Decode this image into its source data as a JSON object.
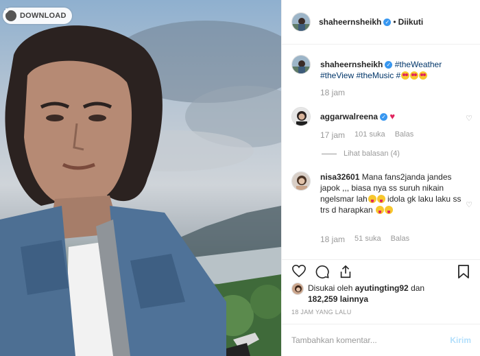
{
  "photo": {
    "download_label": "DOWNLOAD"
  },
  "post": {
    "author": "shaheernsheikh",
    "separator": "•",
    "follow_status": "Diikuti"
  },
  "caption": {
    "author": "shaheernsheikh",
    "tags": [
      "#theWeather",
      "#theView",
      "#theMusic",
      "#"
    ],
    "time": "18 jam"
  },
  "comments": [
    {
      "author": "aggarwalreena",
      "text": "",
      "time": "17 jam",
      "likes": "101 suka",
      "reply": "Balas",
      "view_replies": "Lihat balasan (4)"
    },
    {
      "author": "nisa32601",
      "text": "Mana fans2janda jandes japok ,,, biasa nya ss suruh nikain ngelsmar lah",
      "text2": "idola gk laku laku ss trs d harapkan",
      "time": "18 jam",
      "likes": "51 suka",
      "reply": "Balas"
    }
  ],
  "likes_line": {
    "prefix": "Disukai oleh",
    "user": "ayutingting92",
    "joiner": "dan",
    "count": "182,259",
    "suffix": "lainnya"
  },
  "time_ago": "18 JAM YANG LALU",
  "composer": {
    "placeholder": "Tambahkan komentar...",
    "send_label": "Kirim"
  },
  "icons": {
    "like": "heart-outline-icon",
    "comment": "speech-bubble-icon",
    "share": "share-icon",
    "save": "bookmark-icon",
    "download": "download-arrow-icon"
  },
  "colors": {
    "link": "#003569",
    "verified": "#3897f0",
    "muted": "#999999",
    "send_disabled": "#b2dffc",
    "heart_red": "#ed4956"
  }
}
